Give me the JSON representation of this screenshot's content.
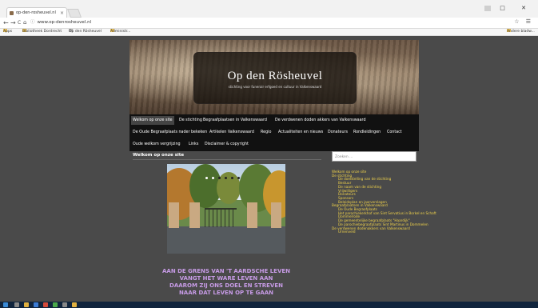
{
  "browser": {
    "tab_title": "op-den-rosheuvel.nl",
    "tab_close": "×",
    "url": "www.op-denrosheuvel.nl",
    "nav_back": "←",
    "nav_forward": "→",
    "nav_reload": "C",
    "nav_home": "⌂",
    "right_icons": "☆ ☰",
    "window_controls": "□ ✕",
    "bookmarks": [
      "Apps",
      "Bibliotheek Dordrecht",
      "Op den Rösheuvel",
      "Administr...",
      "Andere bladw..."
    ]
  },
  "site": {
    "title": "Op den Rösheuvel",
    "subtitle": "stichting voor funerair erfgoed en cultuur in Valkenswaard",
    "menu_row1": [
      "Welkom op onze site",
      "De stichting",
      "Begraafplaatsen in Valkenswaard",
      "De verdwenen doden akkers van Valkenswaard"
    ],
    "menu_row2": [
      "De Oude Begraafplaats nader bekeken",
      "Artikelen Valkenswaard",
      "Regio",
      "Actualiteiten en nieuws",
      "Donateurs",
      "Rondleidingen",
      "Contact"
    ],
    "menu_row3": [
      "Oude welkom vergrijzing",
      "Links",
      "Disclaimer & copyright"
    ],
    "page_heading": "Welkom op onze site",
    "verse": [
      "AAN DE GRENS VAN 'T AARDSCHE LEVEN",
      "VANGT HET WARE LEVEN AAN",
      "DAAROM ZIJ ONS DOEL EN STREVEN",
      "NAAR DAT LEVEN OP TE GAAN"
    ],
    "search_placeholder": "Zoeken ...",
    "sidebar_links": [
      {
        "label": "Welkom op onze site",
        "level": 1
      },
      {
        "label": "De stichting",
        "level": 1
      },
      {
        "label": "De doelstelling van de stichting",
        "level": 2
      },
      {
        "label": "Bestuur",
        "level": 2
      },
      {
        "label": "De naam van de stichting",
        "level": 2
      },
      {
        "label": "Vrijwilligers",
        "level": 2
      },
      {
        "label": "Donateurs",
        "level": 2
      },
      {
        "label": "Sponsors",
        "level": 2
      },
      {
        "label": "Beleidsplan en jaarverslagen",
        "level": 2
      },
      {
        "label": "Begraafplaatsen in Valkenswaard",
        "level": 1
      },
      {
        "label": "De Oude Begraafplaats",
        "level": 2
      },
      {
        "label": "Het parochiekerkhof van Sint Servatius in Borkel en Schaft",
        "level": 2
      },
      {
        "label": "Dommelrode",
        "level": 2
      },
      {
        "label": "De gemeentelijke begraafplaats \"Haardijk\"",
        "level": 2
      },
      {
        "label": "De parochiebegraafplaats Sint Martinus in Dommelen",
        "level": 2
      },
      {
        "label": "De verdwenen dodenakkers van Valkenswaard",
        "level": 1
      },
      {
        "label": "Urnenveld",
        "level": 2
      }
    ]
  },
  "colors": {
    "page_bg": "#4a4a4a",
    "menu_bg": "#111111",
    "sidebar_link": "#f0d24a",
    "verse": "#c79be6"
  }
}
